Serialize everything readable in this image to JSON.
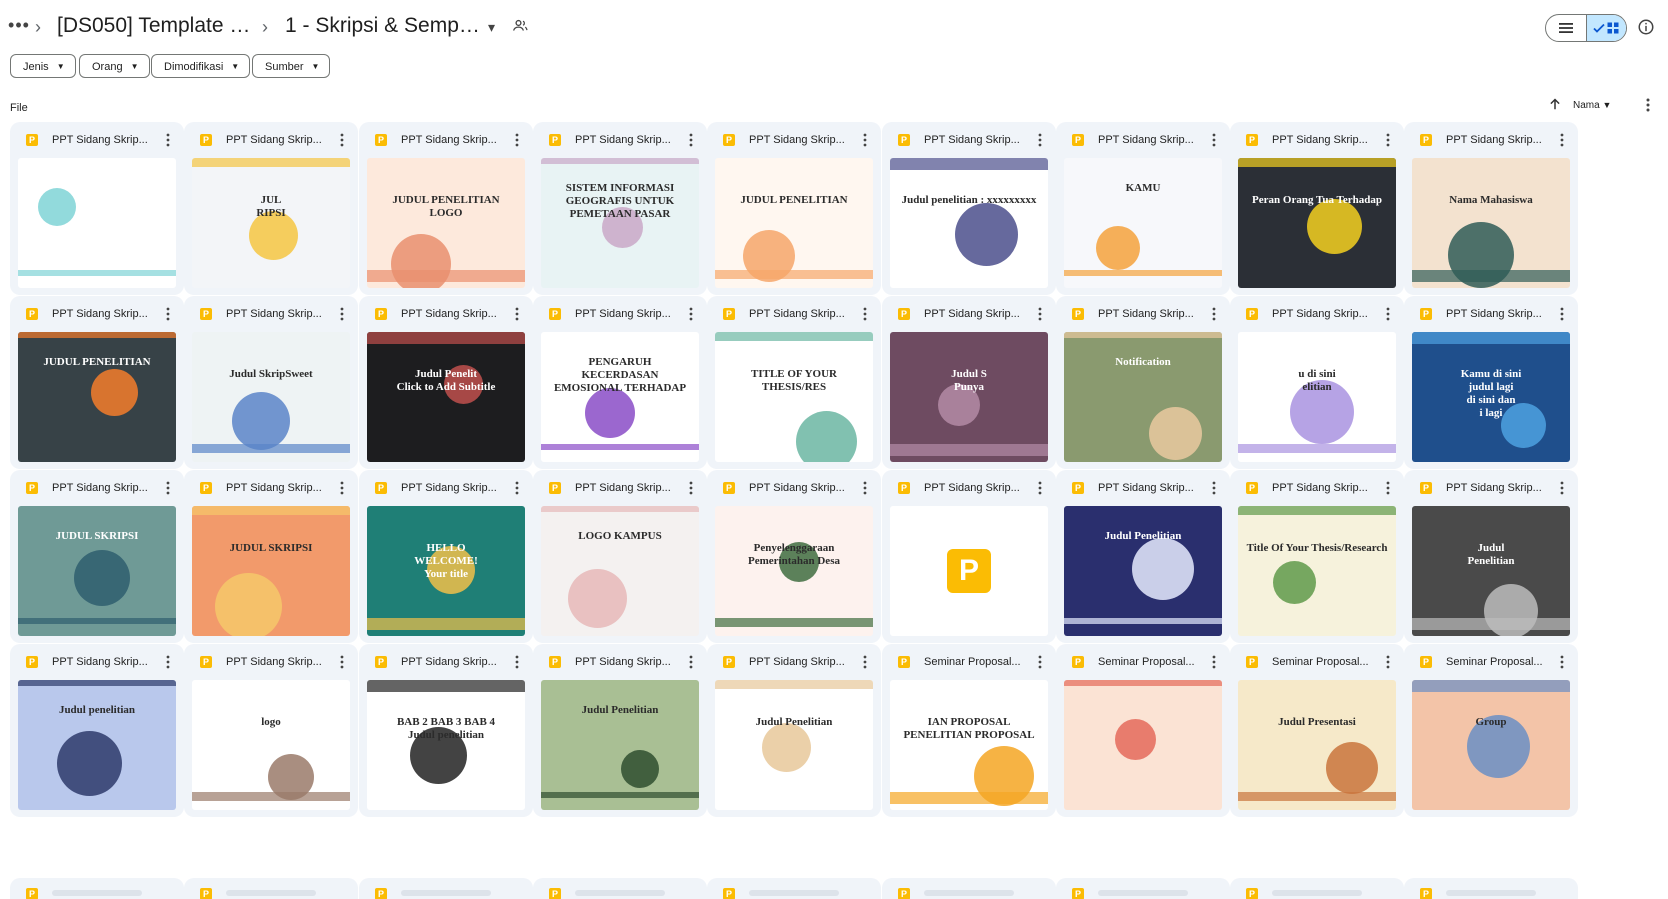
{
  "breadcrumb": {
    "more_label": "•••",
    "items": [
      "[DS050] Template PPT ...",
      "1 - Skripsi & Sempro Ani..."
    ]
  },
  "filters": [
    "Jenis",
    "Orang",
    "Dimodifikasi",
    "Sumber"
  ],
  "section": {
    "label": "File"
  },
  "sort": {
    "label": "Nama"
  },
  "colors": {
    "accent": "#c2e7ff",
    "card_bg": "#f0f4f9",
    "slides_icon": "#fbbc04"
  },
  "files": [
    {
      "title": "PPT Sidang Skrip...",
      "thumb": {
        "bg": "#ffffff",
        "accent": "#7fd3d6",
        "text": "",
        "dark": false
      }
    },
    {
      "title": "PPT Sidang Skrip...",
      "thumb": {
        "bg": "#f3f5f8",
        "accent": "#f4c542",
        "text": "JUL\nRIPSI",
        "dark": true
      }
    },
    {
      "title": "PPT Sidang Skrip...",
      "thumb": {
        "bg": "#fde9dc",
        "accent": "#e98f6e",
        "text": "JUDUL PENELITIAN\nLOGO",
        "dark": true
      }
    },
    {
      "title": "PPT Sidang Skrip...",
      "thumb": {
        "bg": "#e8f3f4",
        "accent": "#c9a7c7",
        "text": "SISTEM INFORMASI GEOGRAFIS UNTUK PEMETAAN PASAR",
        "dark": true
      }
    },
    {
      "title": "PPT Sidang Skrip...",
      "thumb": {
        "bg": "#fff7f0",
        "accent": "#f6a66a",
        "text": "JUDUL PENELITIAN",
        "dark": true
      }
    },
    {
      "title": "PPT Sidang Skrip...",
      "thumb": {
        "bg": "#ffffff",
        "accent": "#4b4f8c",
        "text": "Judul penelitian : xxxxxxxxx",
        "dark": true
      }
    },
    {
      "title": "PPT Sidang Skrip...",
      "thumb": {
        "bg": "#f7f8fb",
        "accent": "#f4a23c",
        "text": "KAMU",
        "dark": true
      }
    },
    {
      "title": "PPT Sidang Skrip...",
      "thumb": {
        "bg": "#2b2f36",
        "accent": "#f5d020",
        "text": "Peran Orang Tua Terhadap",
        "dark": false
      }
    },
    {
      "title": "PPT Sidang Skrip...",
      "thumb": {
        "bg": "#f3e2cf",
        "accent": "#2f5c57",
        "text": "Nama Mahasiswa",
        "dark": true
      }
    },
    {
      "title": "PPT Sidang Skrip...",
      "thumb": {
        "bg": "#374247",
        "accent": "#f57c2b",
        "text": "JUDUL PENELITIAN",
        "dark": false
      }
    },
    {
      "title": "PPT Sidang Skrip...",
      "thumb": {
        "bg": "#eef3f4",
        "accent": "#5a84c8",
        "text": "Judul SkripSweet",
        "dark": true
      }
    },
    {
      "title": "PPT Sidang Skrip...",
      "thumb": {
        "bg": "#1d1d1f",
        "accent": "#c0504d",
        "text": "Judul Penelit\nClick to Add Subtitle",
        "dark": false
      }
    },
    {
      "title": "PPT Sidang Skrip...",
      "thumb": {
        "bg": "#ffffff",
        "accent": "#8a4cc7",
        "text": "PENGARUH KECERDASAN EMOSIONAL TERHADAP",
        "dark": true
      }
    },
    {
      "title": "PPT Sidang Skrip...",
      "thumb": {
        "bg": "#ffffff",
        "accent": "#6bb6a2",
        "text": "TITLE OF YOUR THESIS/RES",
        "dark": true
      }
    },
    {
      "title": "PPT Sidang Skrip...",
      "thumb": {
        "bg": "#6e4b61",
        "accent": "#b48ba6",
        "text": "Judul S\nPunya",
        "dark": false
      }
    },
    {
      "title": "PPT Sidang Skrip...",
      "thumb": {
        "bg": "#8a9a6f",
        "accent": "#e9c9a0",
        "text": "Notification",
        "dark": false
      }
    },
    {
      "title": "PPT Sidang Skrip...",
      "thumb": {
        "bg": "#ffffff",
        "accent": "#a993e0",
        "text": "u di sini\nelitian",
        "dark": true
      }
    },
    {
      "title": "PPT Sidang Skrip...",
      "thumb": {
        "bg": "#1f4f8c",
        "accent": "#4ea1e0",
        "text": "Kamu di sini\njudul lagi\ndi sini dan\ni lagi",
        "dark": false
      }
    },
    {
      "title": "PPT Sidang Skrip...",
      "thumb": {
        "bg": "#6f9a96",
        "accent": "#2f5e6e",
        "text": "JUDUL SKRIPSI",
        "dark": false
      }
    },
    {
      "title": "PPT Sidang Skrip...",
      "thumb": {
        "bg": "#f29a6b",
        "accent": "#f6c86a",
        "text": "JUDUL SKRIPSI",
        "dark": true
      }
    },
    {
      "title": "PPT Sidang Skrip...",
      "thumb": {
        "bg": "#1f7f76",
        "accent": "#f1c04a",
        "text": "HELLO\nWELCOME!\nYour title",
        "dark": false
      }
    },
    {
      "title": "PPT Sidang Skrip...",
      "thumb": {
        "bg": "#f4f1f0",
        "accent": "#e6b9b9",
        "text": "LOGO KAMPUS",
        "dark": true
      }
    },
    {
      "title": "PPT Sidang Skrip...",
      "thumb": {
        "bg": "#fdf2ee",
        "accent": "#3f6d3f",
        "text": "Penyelenggaraan Pemerintahan Desa",
        "dark": true
      }
    },
    {
      "title": "PPT Sidang Skrip...",
      "thumb": {
        "bg": "#ffffff",
        "accent": "#fbbc04",
        "text": "",
        "dark": true,
        "placeholder": true
      }
    },
    {
      "title": "PPT Sidang Skrip...",
      "thumb": {
        "bg": "#2a2f6e",
        "accent": "#e6ebff",
        "text": "Judul Penelitian",
        "dark": false
      }
    },
    {
      "title": "PPT Sidang Skrip...",
      "thumb": {
        "bg": "#f6f2dc",
        "accent": "#5f9a4a",
        "text": "Title Of Your Thesis/Research",
        "dark": true
      }
    },
    {
      "title": "PPT Sidang Skrip...",
      "thumb": {
        "bg": "#4a4a4a",
        "accent": "#bcbcbc",
        "text": "Judul\nPenelitian",
        "dark": false
      }
    },
    {
      "title": "PPT Sidang Skrip...",
      "thumb": {
        "bg": "#b9c8ec",
        "accent": "#2d3a6b",
        "text": "Judul penelitian",
        "dark": true
      }
    },
    {
      "title": "PPT Sidang Skrip...",
      "thumb": {
        "bg": "#ffffff",
        "accent": "#9a7a6a",
        "text": "logo",
        "dark": true
      }
    },
    {
      "title": "PPT Sidang Skrip...",
      "thumb": {
        "bg": "#ffffff",
        "accent": "#222222",
        "text": "BAB 2  BAB 3  BAB 4\nJudul penelitian",
        "dark": true
      }
    },
    {
      "title": "PPT Sidang Skrip...",
      "thumb": {
        "bg": "#a9bf94",
        "accent": "#2f4d2f",
        "text": "Judul Penelitian",
        "dark": true
      }
    },
    {
      "title": "PPT Sidang Skrip...",
      "thumb": {
        "bg": "#ffffff",
        "accent": "#e7c89a",
        "text": "Judul Penelitian",
        "dark": true
      }
    },
    {
      "title": "Seminar Proposal...",
      "thumb": {
        "bg": "#ffffff",
        "accent": "#f5a623",
        "text": "IAN PROPOSAL\nPENELITIAN PROPOSAL",
        "dark": true
      }
    },
    {
      "title": "Seminar Proposal...",
      "thumb": {
        "bg": "#fbe3d4",
        "accent": "#e46a5a",
        "text": "",
        "dark": true
      }
    },
    {
      "title": "Seminar Proposal...",
      "thumb": {
        "bg": "#f6e9c9",
        "accent": "#c9743c",
        "text": "Judul Presentasi",
        "dark": true
      }
    },
    {
      "title": "Seminar Proposal...",
      "thumb": {
        "bg": "#f3c4a8",
        "accent": "#6a8fc4",
        "text": "Group",
        "dark": true
      }
    }
  ]
}
